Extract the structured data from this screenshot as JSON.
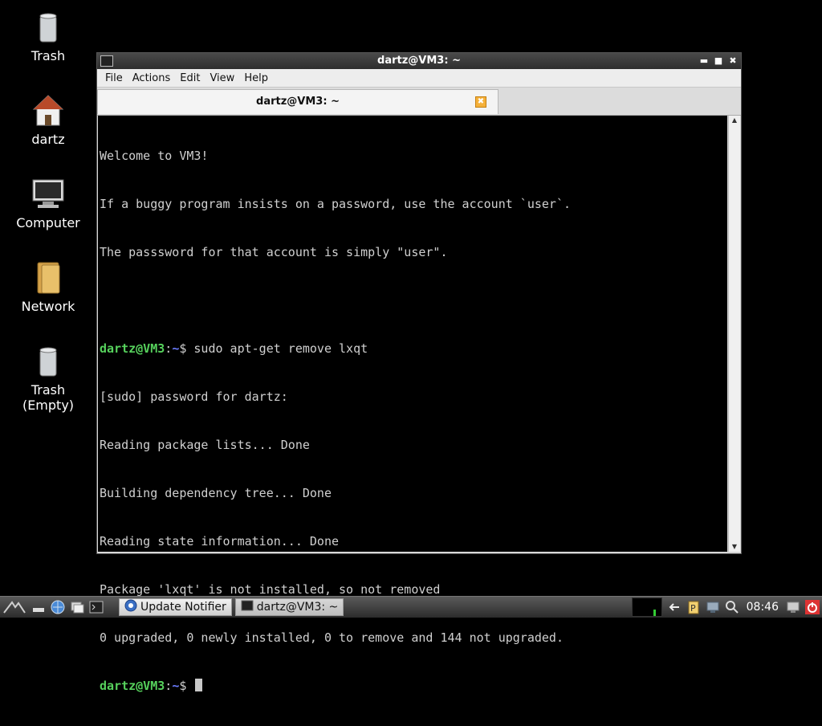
{
  "desktop": {
    "icons": [
      {
        "label": "Trash"
      },
      {
        "label": "dartz"
      },
      {
        "label": "Computer"
      },
      {
        "label": "Network"
      },
      {
        "label": "Trash\n(Empty)"
      }
    ]
  },
  "window": {
    "title": "dartz@VM3: ~",
    "menu": [
      "File",
      "Actions",
      "Edit",
      "View",
      "Help"
    ],
    "tab_title": "dartz@VM3: ~",
    "terminal": {
      "prompt_user": "dartz@VM3",
      "prompt_sep": ":",
      "prompt_path": "~",
      "prompt_dollar": "$ ",
      "lines": [
        "Welcome to VM3!",
        "If a buggy program insists on a password, use the account `user`.",
        "The passsword for that account is simply \"user\".",
        "",
        "sudo apt-get remove lxqt",
        "[sudo] password for dartz:",
        "Reading package lists... Done",
        "Building dependency tree... Done",
        "Reading state information... Done",
        "Package 'lxqt' is not installed, so not removed",
        "0 upgraded, 0 newly installed, 0 to remove and 144 not upgraded.",
        ""
      ]
    }
  },
  "taskbar": {
    "tasks": [
      "Update Notifier",
      "dartz@VM3: ~"
    ],
    "clock": "08:46"
  },
  "colors": {
    "prompt_user": "#56d15c",
    "prompt_path": "#6b7cff",
    "terminal_bg": "#000000"
  }
}
